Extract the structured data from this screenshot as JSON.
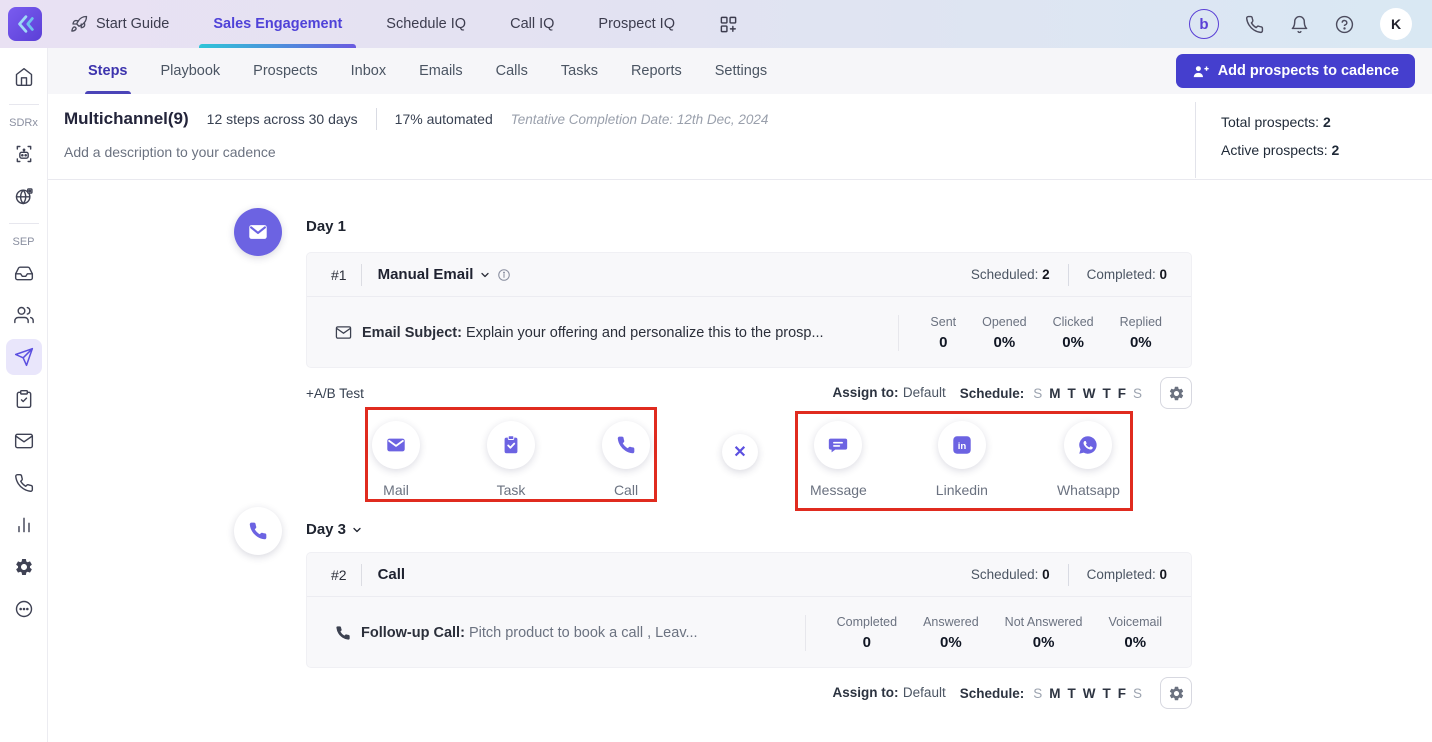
{
  "colors": {
    "accent": "#453fce",
    "active_purple": "#4f42d8",
    "icon_purple": "#6c63e2",
    "annotation_red": "#e02b1f",
    "topbar_gradient": [
      "#e9e1f3",
      "#d9e8f3"
    ]
  },
  "topbar": {
    "nav": [
      {
        "label": "Start Guide"
      },
      {
        "label": "Sales Engagement"
      },
      {
        "label": "Schedule IQ"
      },
      {
        "label": "Call IQ"
      },
      {
        "label": "Prospect IQ"
      }
    ],
    "b_badge": "b",
    "avatar_initial": "K"
  },
  "sidebar": {
    "label_sdrx": "SDRx",
    "label_sep": "SEP"
  },
  "subnav": {
    "tabs": [
      "Steps",
      "Playbook",
      "Prospects",
      "Inbox",
      "Emails",
      "Calls",
      "Tasks",
      "Reports",
      "Settings"
    ],
    "active_tab": "Steps",
    "add_button": "Add prospects to cadence"
  },
  "header": {
    "title": "Multichannel(9)",
    "steps_info": "12 steps across 30 days",
    "automated": "17% automated",
    "completion_date": "Tentative Completion Date: 12th Dec, 2024",
    "description": "Add a description to your cadence",
    "total_label": "Total prospects:",
    "total_value": "2",
    "active_label": "Active prospects:",
    "active_value": "2"
  },
  "assign": {
    "label": "Assign to:",
    "value": "Default",
    "schedule_label": "Schedule:",
    "days": [
      "S",
      "M",
      "T",
      "W",
      "T",
      "F",
      "S"
    ]
  },
  "day1": {
    "label": "Day 1",
    "step_num": "#1",
    "step_type": "Manual Email",
    "scheduled_label": "Scheduled:",
    "scheduled_value": "2",
    "completed_label": "Completed:",
    "completed_value": "0",
    "subject_label": "Email Subject:",
    "subject_text": "Explain your offering and personalize this to the prosp...",
    "ab_test": "+A/B Test",
    "stats": [
      {
        "label": "Sent",
        "value": "0"
      },
      {
        "label": "Opened",
        "value": "0%"
      },
      {
        "label": "Clicked",
        "value": "0%"
      },
      {
        "label": "Replied",
        "value": "0%"
      }
    ]
  },
  "channel_picker": {
    "left": [
      {
        "label": "Mail"
      },
      {
        "label": "Task"
      },
      {
        "label": "Call"
      }
    ],
    "right": [
      {
        "label": "Message"
      },
      {
        "label": "Linkedin"
      },
      {
        "label": "Whatsapp"
      }
    ],
    "close": "✕"
  },
  "day3": {
    "label": "Day 3",
    "step_num": "#2",
    "step_type": "Call",
    "scheduled_label": "Scheduled:",
    "scheduled_value": "0",
    "completed_label": "Completed:",
    "completed_value": "0",
    "call_label": "Follow-up Call:",
    "call_text": "Pitch product to book a call , Leav...",
    "stats": [
      {
        "label": "Completed",
        "value": "0"
      },
      {
        "label": "Answered",
        "value": "0%"
      },
      {
        "label": "Not Answered",
        "value": "0%"
      },
      {
        "label": "Voicemail",
        "value": "0%"
      }
    ]
  }
}
